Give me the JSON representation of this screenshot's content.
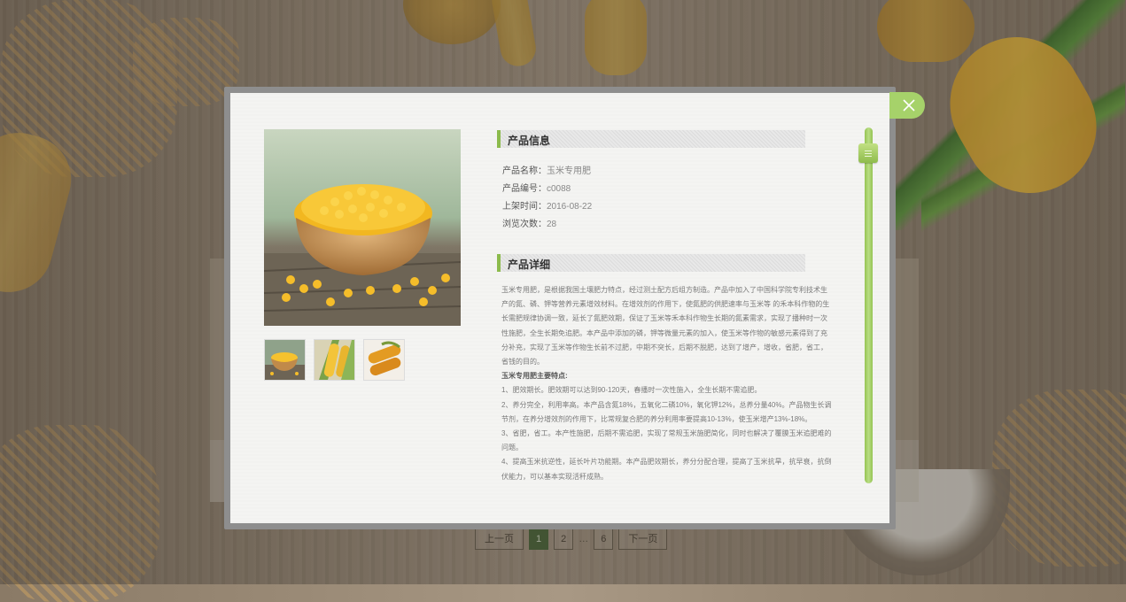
{
  "pagination": {
    "prev": "上一页",
    "pages": [
      "1",
      "2"
    ],
    "dots": "…",
    "last": "6",
    "next": "下一页",
    "active_page": "1"
  },
  "modal": {
    "close_icon": "close-icon",
    "info_title": "产品信息",
    "info": [
      {
        "key": "产品名称：",
        "value": "玉米专用肥"
      },
      {
        "key": "产品编号：",
        "value": "c0088"
      },
      {
        "key": "上架时间：",
        "value": "2016-08-22"
      },
      {
        "key": "浏览次数：",
        "value": "28"
      }
    ],
    "detail_title": "产品详细",
    "detail_paragraphs": [
      "玉米专用肥，是根据我国土壤肥力特点，经过测土配方后组方制造。产品中加入了中国科学院专利技术生产的氮、磷、钾等营养元素增效材料。在增效剂的作用下，使氮肥的供肥速率与玉米等 的禾本科作物的生长需肥规律协调一致，延长了氮肥效期，保证了玉米等禾本科作物生长期的氮素需求，实现了播种时一次性施肥，全生长期免追肥。本产品中添加的磷，钾等微量元素的加入，使玉米等作物的敏感元素得到了充分补充，实现了玉米等作物生长前不过肥，中期不突长，后期不脱肥，达到了增产，增收，省肥，省工，省钱的目的。"
    ],
    "features_title": "玉米专用肥主要特点:",
    "features": [
      "1、肥效期长。肥效期可以达到90-120天，春播时一次性施入，全生长期不需追肥。",
      "2、养分完全，利用率高。本产品含氮18%，五氧化二磷10%，氧化钾12%，总养分量40%。产品物生长调节剂，在养分增效剂的作用下，比常规复合肥的养分利用率要提高10-13%，使玉米增产13%-18%。",
      "3、省肥，省工。本产性施肥，后期不需追肥，实现了常规玉米施肥简化，同时也解决了覆膜玉米追肥难的问题。",
      "4、提高玉米抗逆性，延长叶片功能期。本产品肥效期长，养分分配合理，提高了玉米抗旱，抗早衰，抗倒伏能力，可以基本实现活秆成熟。"
    ]
  }
}
